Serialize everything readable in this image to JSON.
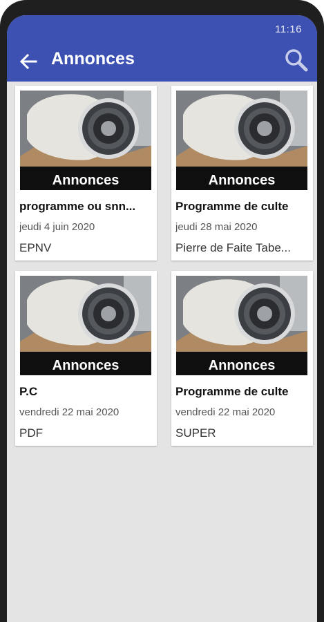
{
  "status_bar": {
    "time": "11:16"
  },
  "app_bar": {
    "title": "Annonces",
    "back_icon": "arrow-left-icon",
    "search_icon": "search-icon",
    "color": "#3d51b3"
  },
  "cards": [
    {
      "image_caption": "Annonces",
      "title": "programme ou snn...",
      "date": "jeudi 4 juin 2020",
      "author": "EPNV"
    },
    {
      "image_caption": "Annonces",
      "title": "Programme de culte",
      "date": "jeudi 28 mai 2020",
      "author": "Pierre de Faite Tabe..."
    },
    {
      "image_caption": "Annonces",
      "title": "P.C",
      "date": "vendredi 22 mai 2020",
      "author": "PDF"
    },
    {
      "image_caption": "Annonces",
      "title": "Programme de culte",
      "date": "vendredi 22 mai 2020",
      "author": "SUPER"
    }
  ]
}
